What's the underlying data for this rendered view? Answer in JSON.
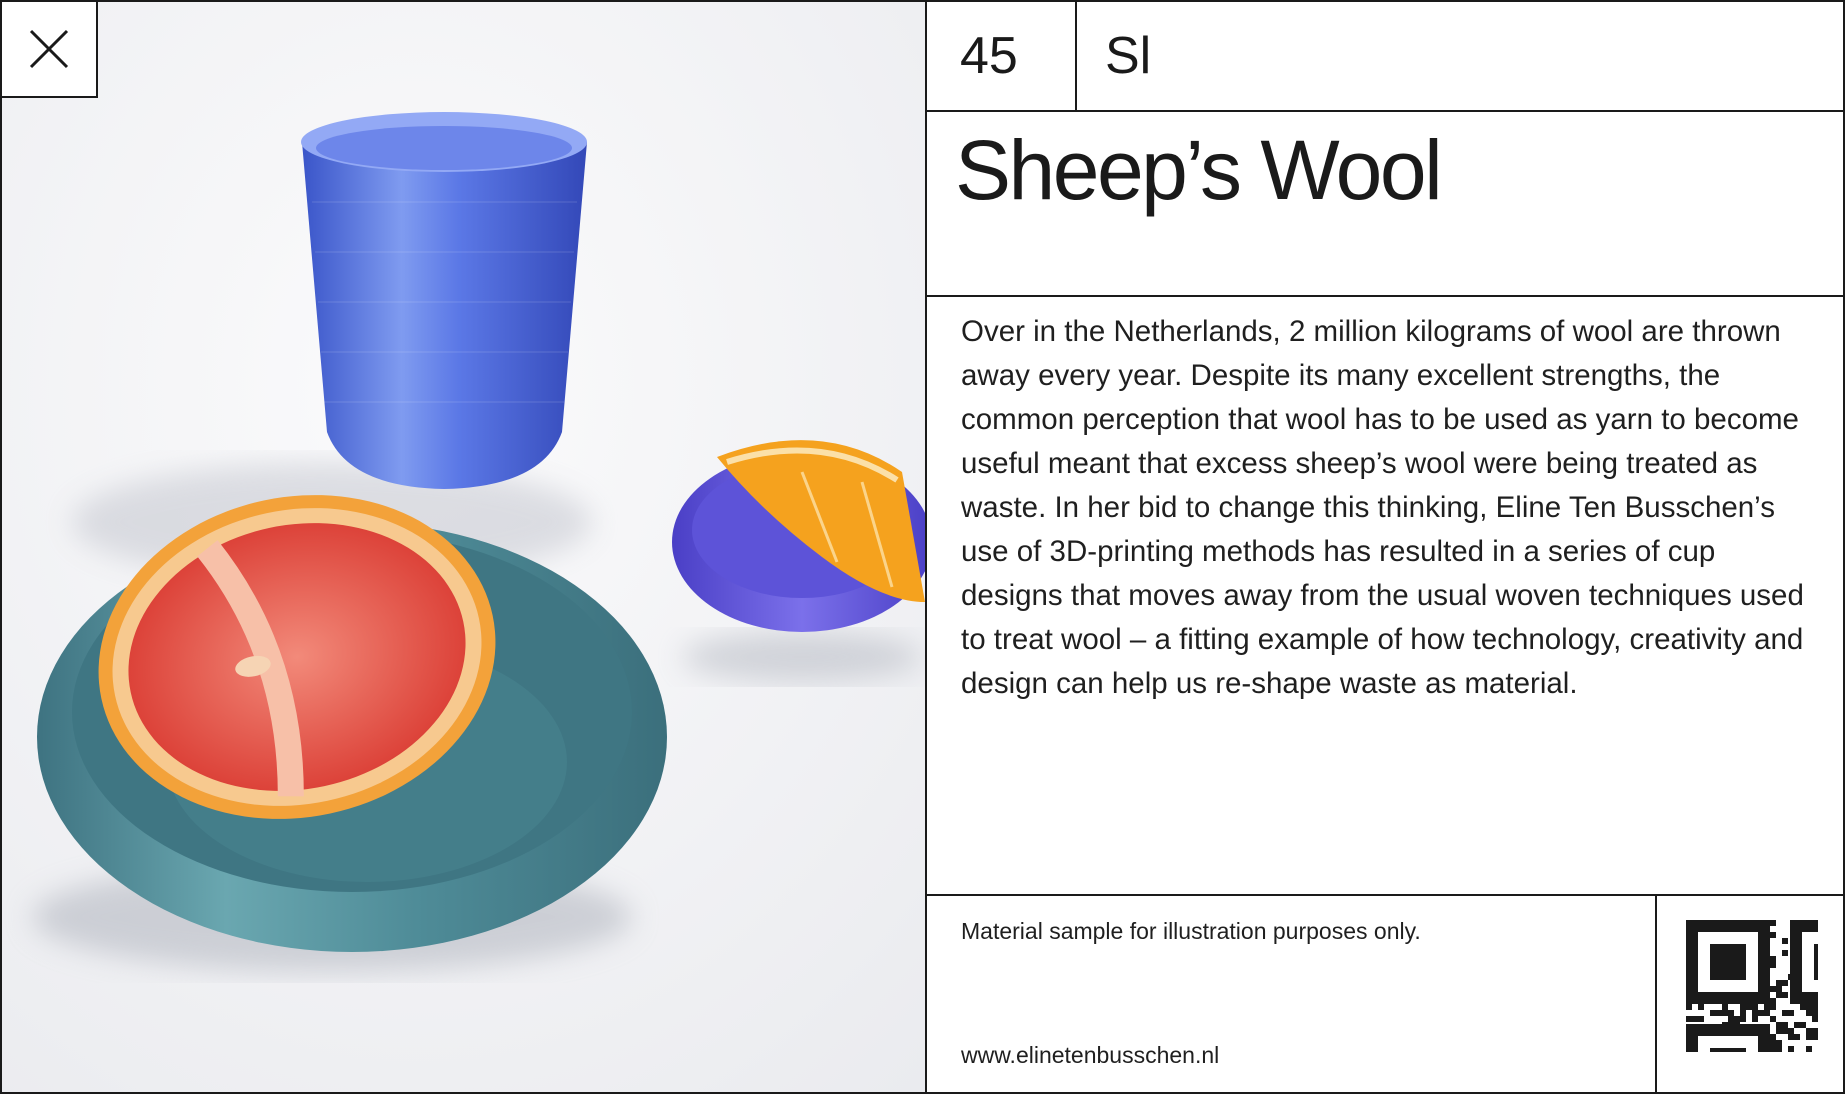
{
  "photo": {
    "alt_subject": "",
    "colors": {
      "background": "#f2f3f5",
      "cup": "#4f6fe0",
      "bowl_large": "#4e8a96",
      "bowl_small": "#5a4fd6",
      "grapefruit_flesh": "#e04a3c",
      "grapefruit_rind": "#f3a23a",
      "orange": "#f5a21e"
    }
  },
  "close_button": {
    "icon": "close-icon"
  },
  "material": {
    "number": "45",
    "code": "Sl",
    "title": "Sheep’s Wool",
    "description": "Over in the Netherlands, 2 million kilograms of wool are thrown away every year. Despite its many excellent strengths, the common perception that wool has to be used as yarn to become useful meant that excess sheep’s wool were being treated as waste. In her bid to change this thinking, Eline Ten Busschen’s use of 3D-printing methods has resulted in a series of cup designs that moves away from the usual woven techniques used to treat wool – a fitting example of how technology, creativity and design can help us re-shape waste as material."
  },
  "footer": {
    "disclaimer": "Material sample for illustration purposes only.",
    "website": "www.elinetenbusschen.nl",
    "qr_icon": "qr-code-icon"
  },
  "colors": {
    "ink": "#1a1a1a",
    "paper": "#ffffff"
  }
}
